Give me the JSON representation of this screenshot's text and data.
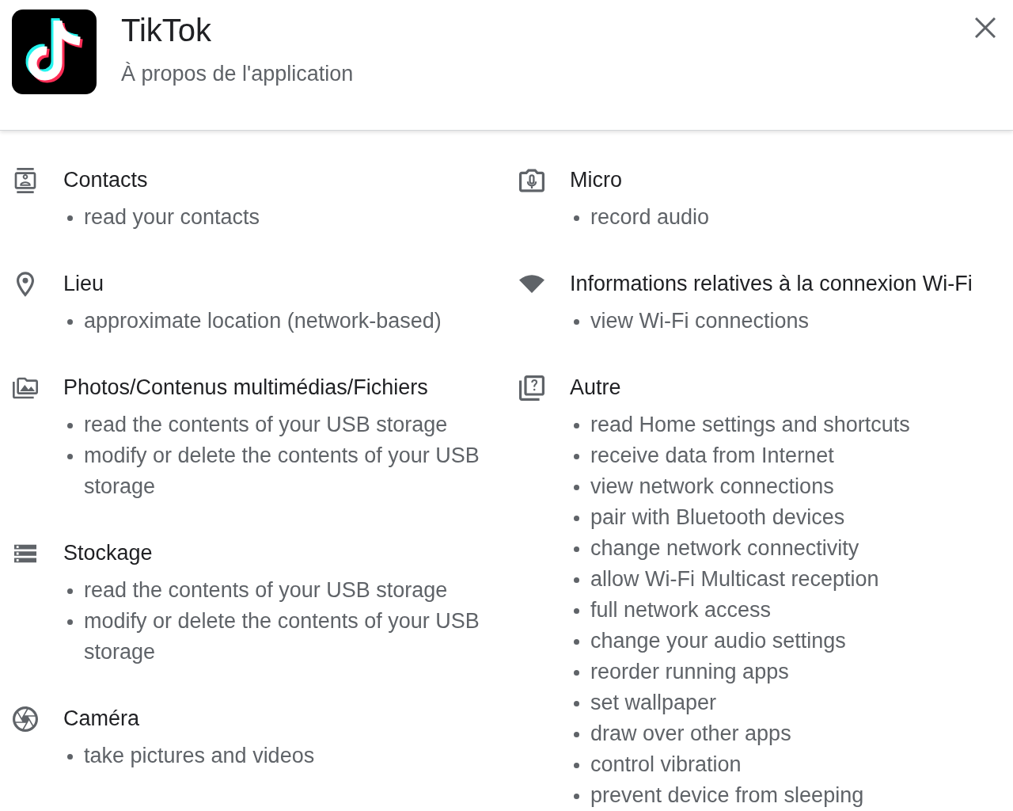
{
  "app": {
    "name": "TikTok",
    "subtitle": "À propos de l'application"
  },
  "permissions": {
    "columns": [
      {
        "groups": [
          {
            "kind": "contacts",
            "title": "Contacts",
            "items": [
              "read your contacts"
            ]
          },
          {
            "kind": "location",
            "title": "Lieu",
            "items": [
              "approximate location (network-based)"
            ]
          },
          {
            "kind": "media",
            "title": "Photos/Contenus multimédias/Fichiers",
            "items": [
              "read the contents of your USB storage",
              "modify or delete the contents of your USB storage"
            ]
          },
          {
            "kind": "storage",
            "title": "Stockage",
            "items": [
              "read the contents of your USB storage",
              "modify or delete the contents of your USB storage"
            ]
          },
          {
            "kind": "camera",
            "title": "Caméra",
            "items": [
              "take pictures and videos"
            ]
          }
        ]
      },
      {
        "groups": [
          {
            "kind": "microphone",
            "title": "Micro",
            "items": [
              "record audio"
            ]
          },
          {
            "kind": "wifi",
            "title": "Informations relatives à la connexion Wi-Fi",
            "items": [
              "view Wi-Fi connections"
            ]
          },
          {
            "kind": "other",
            "title": "Autre",
            "items": [
              "read Home settings and shortcuts",
              "receive data from Internet",
              "view network connections",
              "pair with Bluetooth devices",
              "change network connectivity",
              "allow Wi-Fi Multicast reception",
              "full network access",
              "change your audio settings",
              "reorder running apps",
              "set wallpaper",
              "draw over other apps",
              "control vibration",
              "prevent device from sleeping"
            ]
          }
        ]
      }
    ]
  }
}
